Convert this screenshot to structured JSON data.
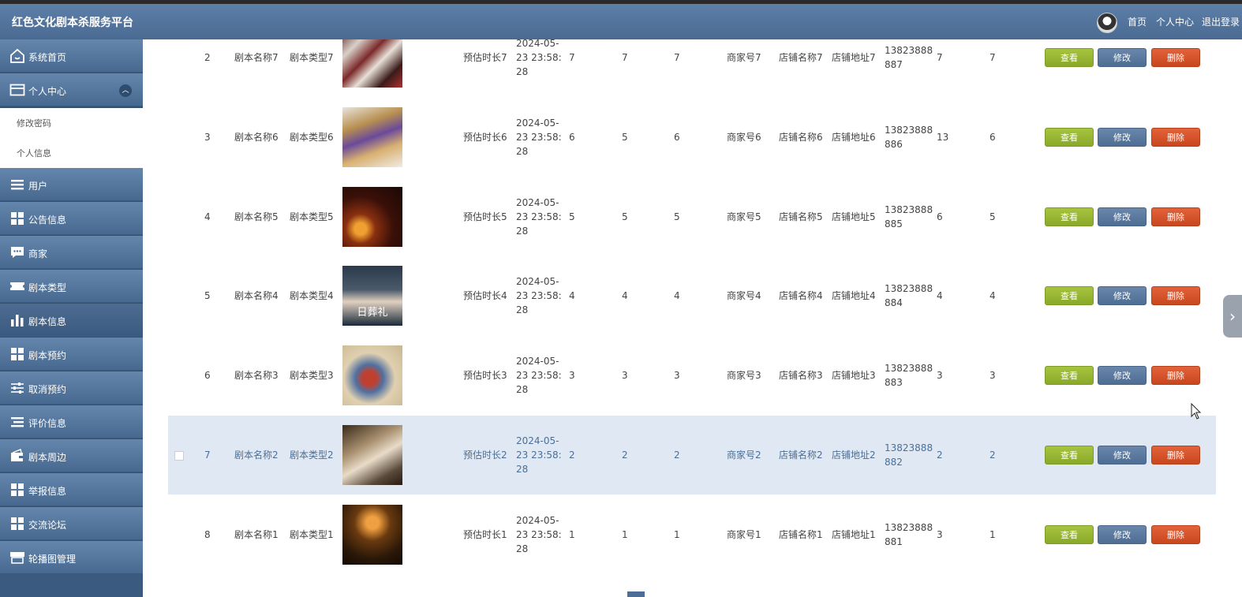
{
  "header": {
    "brand": "红色文化剧本杀服务平台",
    "nav": [
      "首页",
      "个人中心",
      "退出登录"
    ]
  },
  "sidebar": {
    "items": [
      {
        "label": "系统首页",
        "icon": "home-icon"
      },
      {
        "label": "个人中心",
        "icon": "card-icon",
        "expanded": true,
        "sub": [
          "修改密码",
          "个人信息"
        ]
      },
      {
        "label": "用户",
        "icon": "list-icon"
      },
      {
        "label": "公告信息",
        "icon": "grid-icon"
      },
      {
        "label": "商家",
        "icon": "chat-icon"
      },
      {
        "label": "剧本类型",
        "icon": "ticket-icon"
      },
      {
        "label": "剧本信息",
        "icon": "bar-chart-icon",
        "active": true
      },
      {
        "label": "剧本预约",
        "icon": "grid-icon"
      },
      {
        "label": "取消预约",
        "icon": "sliders-icon"
      },
      {
        "label": "评价信息",
        "icon": "list-icon"
      },
      {
        "label": "剧本周边",
        "icon": "wallet-icon"
      },
      {
        "label": "举报信息",
        "icon": "grid-icon"
      },
      {
        "label": "交流论坛",
        "icon": "grid-icon"
      },
      {
        "label": "轮播图管理",
        "icon": "store-icon"
      }
    ]
  },
  "actions": {
    "view": "查看",
    "edit": "修改",
    "delete": "删除"
  },
  "rows": [
    {
      "idx": "2",
      "name": "剧本名称7",
      "type": "剧本类型7",
      "duration": "预估时长7",
      "date1": "2024-05-",
      "date2": "23 23:58:",
      "date3": "28",
      "a": "7",
      "b": "7",
      "c": "7",
      "merchant": "商家号7",
      "shop": "店铺名称7",
      "addr": "店铺地址7",
      "phone1": "13823888",
      "phone2": "887",
      "d": "7",
      "e": "7",
      "img": "a"
    },
    {
      "idx": "3",
      "name": "剧本名称6",
      "type": "剧本类型6",
      "duration": "预估时长6",
      "date1": "2024-05-",
      "date2": "23 23:58:",
      "date3": "28",
      "a": "6",
      "b": "5",
      "c": "6",
      "merchant": "商家号6",
      "shop": "店铺名称6",
      "addr": "店铺地址6",
      "phone1": "13823888",
      "phone2": "886",
      "d": "13",
      "e": "6",
      "img": "b"
    },
    {
      "idx": "4",
      "name": "剧本名称5",
      "type": "剧本类型5",
      "duration": "预估时长5",
      "date1": "2024-05-",
      "date2": "23 23:58:",
      "date3": "28",
      "a": "5",
      "b": "5",
      "c": "5",
      "merchant": "商家号5",
      "shop": "店铺名称5",
      "addr": "店铺地址5",
      "phone1": "13823888",
      "phone2": "885",
      "d": "6",
      "e": "5",
      "img": "c"
    },
    {
      "idx": "5",
      "name": "剧本名称4",
      "type": "剧本类型4",
      "duration": "预估时长4",
      "date1": "2024-05-",
      "date2": "23 23:58:",
      "date3": "28",
      "a": "4",
      "b": "4",
      "c": "4",
      "merchant": "商家号4",
      "shop": "店铺名称4",
      "addr": "店铺地址4",
      "phone1": "13823888",
      "phone2": "884",
      "d": "4",
      "e": "4",
      "img": "d",
      "poster_text": "日葬礼"
    },
    {
      "idx": "6",
      "name": "剧本名称3",
      "type": "剧本类型3",
      "duration": "预估时长3",
      "date1": "2024-05-",
      "date2": "23 23:58:",
      "date3": "28",
      "a": "3",
      "b": "3",
      "c": "3",
      "merchant": "商家号3",
      "shop": "店铺名称3",
      "addr": "店铺地址3",
      "phone1": "13823888",
      "phone2": "883",
      "d": "3",
      "e": "3",
      "img": "e"
    },
    {
      "idx": "7",
      "name": "剧本名称2",
      "type": "剧本类型2",
      "duration": "预估时长2",
      "date1": "2024-05-",
      "date2": "23 23:58:",
      "date3": "28",
      "a": "2",
      "b": "2",
      "c": "2",
      "merchant": "商家号2",
      "shop": "店铺名称2",
      "addr": "店铺地址2",
      "phone1": "13823888",
      "phone2": "882",
      "d": "2",
      "e": "2",
      "img": "f",
      "highlighted": true
    },
    {
      "idx": "8",
      "name": "剧本名称1",
      "type": "剧本类型1",
      "duration": "预估时长1",
      "date1": "2024-05-",
      "date2": "23 23:58:",
      "date3": "28",
      "a": "1",
      "b": "1",
      "c": "1",
      "merchant": "商家号1",
      "shop": "店铺名称1",
      "addr": "店铺地址1",
      "phone1": "13823888",
      "phone2": "881",
      "d": "3",
      "e": "1",
      "img": "g"
    }
  ]
}
